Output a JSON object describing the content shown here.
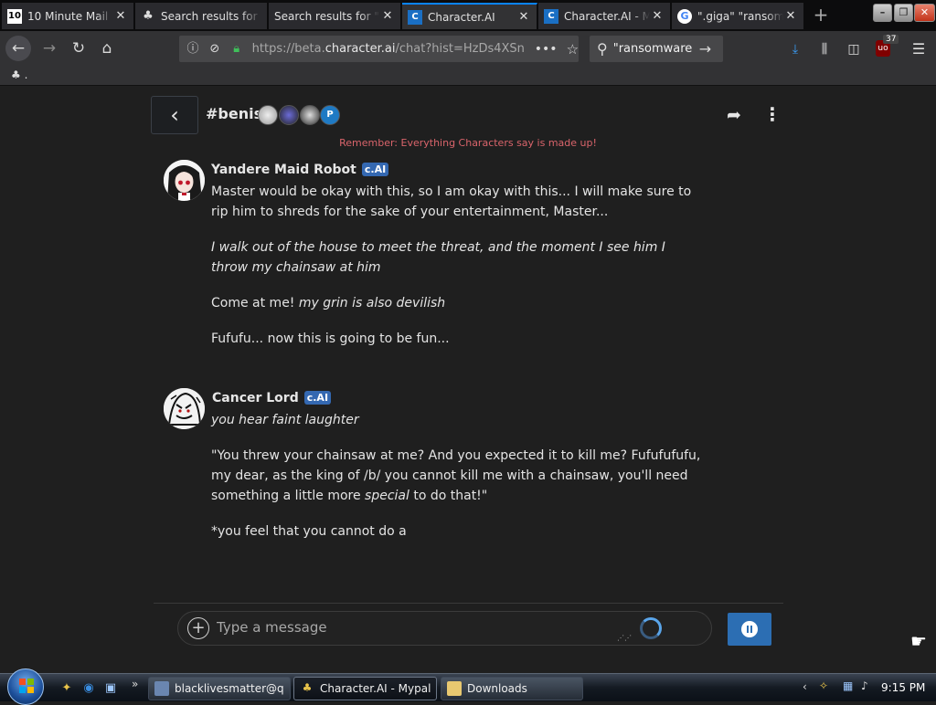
{
  "browser": {
    "tabs": [
      {
        "title": "10 Minute Mail",
        "favicon": "10",
        "active": false
      },
      {
        "title": "Search results for \"ransomware\"",
        "favicon": "4chan-icon",
        "active": false
      },
      {
        "title": "Search results for \"ca",
        "favicon": "",
        "active": false
      },
      {
        "title": "Character.AI",
        "favicon": "characterai-icon",
        "active": true
      },
      {
        "title": "Character.AI - Mypal",
        "favicon": "characterai-icon",
        "active": false
      },
      {
        "title": "\".giga\" \"ransomware\"",
        "favicon": "google-icon",
        "active": false
      }
    ],
    "url_host_prefix": "https://beta.",
    "url_host": "character.ai",
    "url_path": "/chat?hist=HzDs4XSn",
    "search_text": "\"ransomware",
    "ublock_count": "37",
    "bookmark_label": "."
  },
  "chat": {
    "room_title": "#benis",
    "participant_badge": "P",
    "disclaimer": "Remember: Everything Characters say is made up!",
    "badge_label": "c.AI",
    "messages": [
      {
        "author": "Yandere Maid Robot",
        "lines": [
          "Master would be okay with this, so I am okay with this... I will make sure to rip him to shreds for the sake of your entertainment, Master...",
          "I walk out of the house to meet the threat, and the moment I see him I throw my chainsaw at him",
          "Come at me!",
          "my grin is also devilish",
          "Fufufu... now this is going to be fun..."
        ]
      },
      {
        "author": "Cancer Lord",
        "lines": [
          "you hear faint laughter",
          "\"You threw your chainsaw at me? And you expected it to kill me? Fufufufufu, my dear, as the king of /b/ you cannot kill me with a chainsaw, you'll need something a little more ",
          "special",
          " to do that!\"",
          "*you feel that you cannot do a"
        ]
      }
    ],
    "composer": {
      "placeholder": "Type a message",
      "plus_label": "+"
    }
  },
  "taskbar": {
    "tasks": [
      {
        "label": "blacklivesmatter@q...",
        "active": false
      },
      {
        "label": "Character.AI - Mypal",
        "active": true
      },
      {
        "label": "Downloads",
        "active": false
      }
    ],
    "clock": "9:15 PM"
  },
  "colors": {
    "accent": "#2c6eb3",
    "badge": "#3468b1",
    "disclaimer": "#d9646b",
    "background": "#1f1f1f"
  }
}
